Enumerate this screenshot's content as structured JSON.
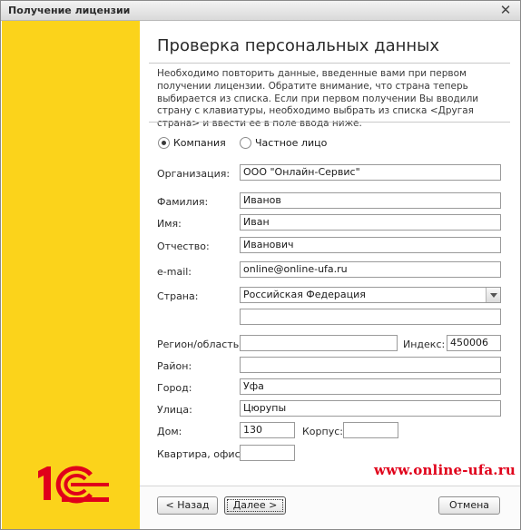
{
  "window": {
    "title": "Получение лицензии",
    "close_glyph": "✕"
  },
  "header": {
    "title": "Проверка персональных данных",
    "description": "Необходимо повторить данные, введенные вами при первом получении лицензии. Обратите внимание, что страна теперь выбирается из списка. Если при первом получении Вы вводили страну с клавиатуры, необходимо выбрать из списка <Другая страна> и ввести ее в поле ввода ниже."
  },
  "type_options": {
    "company": {
      "label": "Компания",
      "selected": true
    },
    "individual": {
      "label": "Частное лицо",
      "selected": false
    }
  },
  "form": {
    "organization": {
      "label": "Организация:",
      "value": "ООО \"Онлайн-Сервис\""
    },
    "last_name": {
      "label": "Фамилия:",
      "value": "Иванов"
    },
    "first_name": {
      "label": "Имя:",
      "value": "Иван"
    },
    "patronymic": {
      "label": "Отчество:",
      "value": "Иванович"
    },
    "email": {
      "label": "e-mail:",
      "value": "online@online-ufa.ru"
    },
    "country": {
      "label": "Страна:",
      "value": "Российская Федерация",
      "other_value": ""
    },
    "region": {
      "label": "Регион/область:",
      "value": ""
    },
    "postal_code": {
      "label": "Индекс:",
      "value": "450006"
    },
    "district": {
      "label": "Район:",
      "value": ""
    },
    "city": {
      "label": "Город:",
      "value": "Уфа"
    },
    "street": {
      "label": "Улица:",
      "value": "Цюрупы"
    },
    "house": {
      "label": "Дом:",
      "value": "130"
    },
    "building": {
      "label": "Корпус:",
      "value": ""
    },
    "apartment": {
      "label": "Квартира, офис:",
      "value": ""
    }
  },
  "watermark": "www.online-ufa.ru",
  "buttons": {
    "back": "< Назад",
    "next": "Далее >",
    "cancel": "Отмена"
  },
  "colors": {
    "sidebar": "#fbd31b",
    "logo_red": "#e0001a"
  },
  "icons": {
    "logo": "1c-logo",
    "close": "close-icon",
    "dropdown": "chevron-down-icon"
  }
}
